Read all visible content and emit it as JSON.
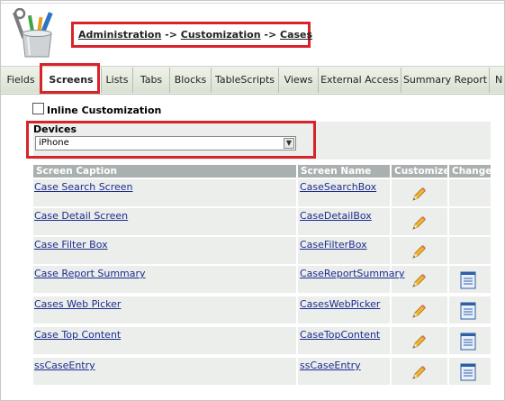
{
  "breadcrumb": {
    "items": [
      "Administration",
      "Customization",
      "Cases"
    ],
    "separator": "->"
  },
  "tabs": [
    {
      "label": "Fields"
    },
    {
      "label": "Screens",
      "active": true
    },
    {
      "label": "Lists"
    },
    {
      "label": "Tabs"
    },
    {
      "label": "Blocks"
    },
    {
      "label": "TableScripts"
    },
    {
      "label": "Views"
    },
    {
      "label": "External Access"
    },
    {
      "label": "Summary Report"
    },
    {
      "label": "N"
    }
  ],
  "inline_customization": {
    "label": "Inline Customization",
    "checked": false
  },
  "devices": {
    "label": "Devices",
    "selected": "iPhone"
  },
  "table": {
    "headers": [
      "Screen Caption",
      "Screen Name",
      "Customize",
      "Change"
    ],
    "rows": [
      {
        "caption": "Case Search Screen",
        "name": "CaseSearchBox",
        "customize": true,
        "change": false
      },
      {
        "caption": "Case Detail Screen",
        "name": "CaseDetailBox",
        "customize": true,
        "change": false
      },
      {
        "caption": "Case Filter Box",
        "name": "CaseFilterBox",
        "customize": true,
        "change": false
      },
      {
        "caption": "Case Report Summary",
        "name": "CaseReportSummary",
        "customize": true,
        "change": true
      },
      {
        "caption": "Cases Web Picker",
        "name": "CasesWebPicker",
        "customize": true,
        "change": true
      },
      {
        "caption": "Case Top Content",
        "name": "CaseTopContent",
        "customize": true,
        "change": true
      },
      {
        "caption": "ssCaseEntry",
        "name": "ssCaseEntry",
        "customize": true,
        "change": true
      }
    ]
  },
  "colors": {
    "highlight": "#d8232a",
    "link": "#1b2c8f",
    "header_bg": "#aab0b0"
  }
}
